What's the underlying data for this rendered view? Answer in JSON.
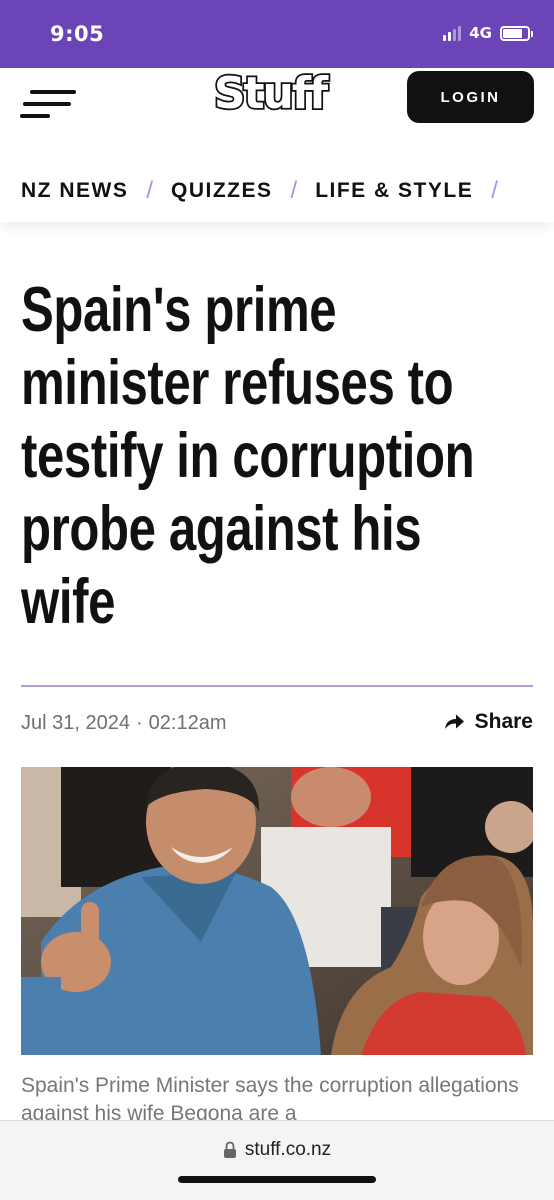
{
  "status_bar": {
    "time": "9:05",
    "network": "4G",
    "battery_level": 0.8,
    "color": "#6b44b8"
  },
  "header": {
    "logo_text": "Stuff",
    "login_label": "LOGIN",
    "menu_icon": "hamburger-menu-icon"
  },
  "nav": {
    "items": [
      {
        "label": "NZ NEWS"
      },
      {
        "label": "QUIZZES"
      },
      {
        "label": "LIFE & STYLE"
      }
    ],
    "separator": "/",
    "separator_color": "#b58ae8"
  },
  "article": {
    "headline_lines": [
      "Spain's prime",
      "minister refuses to",
      "testify in corruption",
      "probe against his",
      "wife"
    ],
    "date": "Jul 31, 2024",
    "time": "02:12am",
    "share_label": "Share",
    "share_icon": "share-arrow-icon",
    "caption": "Spain's Prime Minister says the corruption allegations against his wife Begona are a"
  },
  "browser": {
    "url": "stuff.co.nz",
    "lock_icon": "lock-icon"
  }
}
